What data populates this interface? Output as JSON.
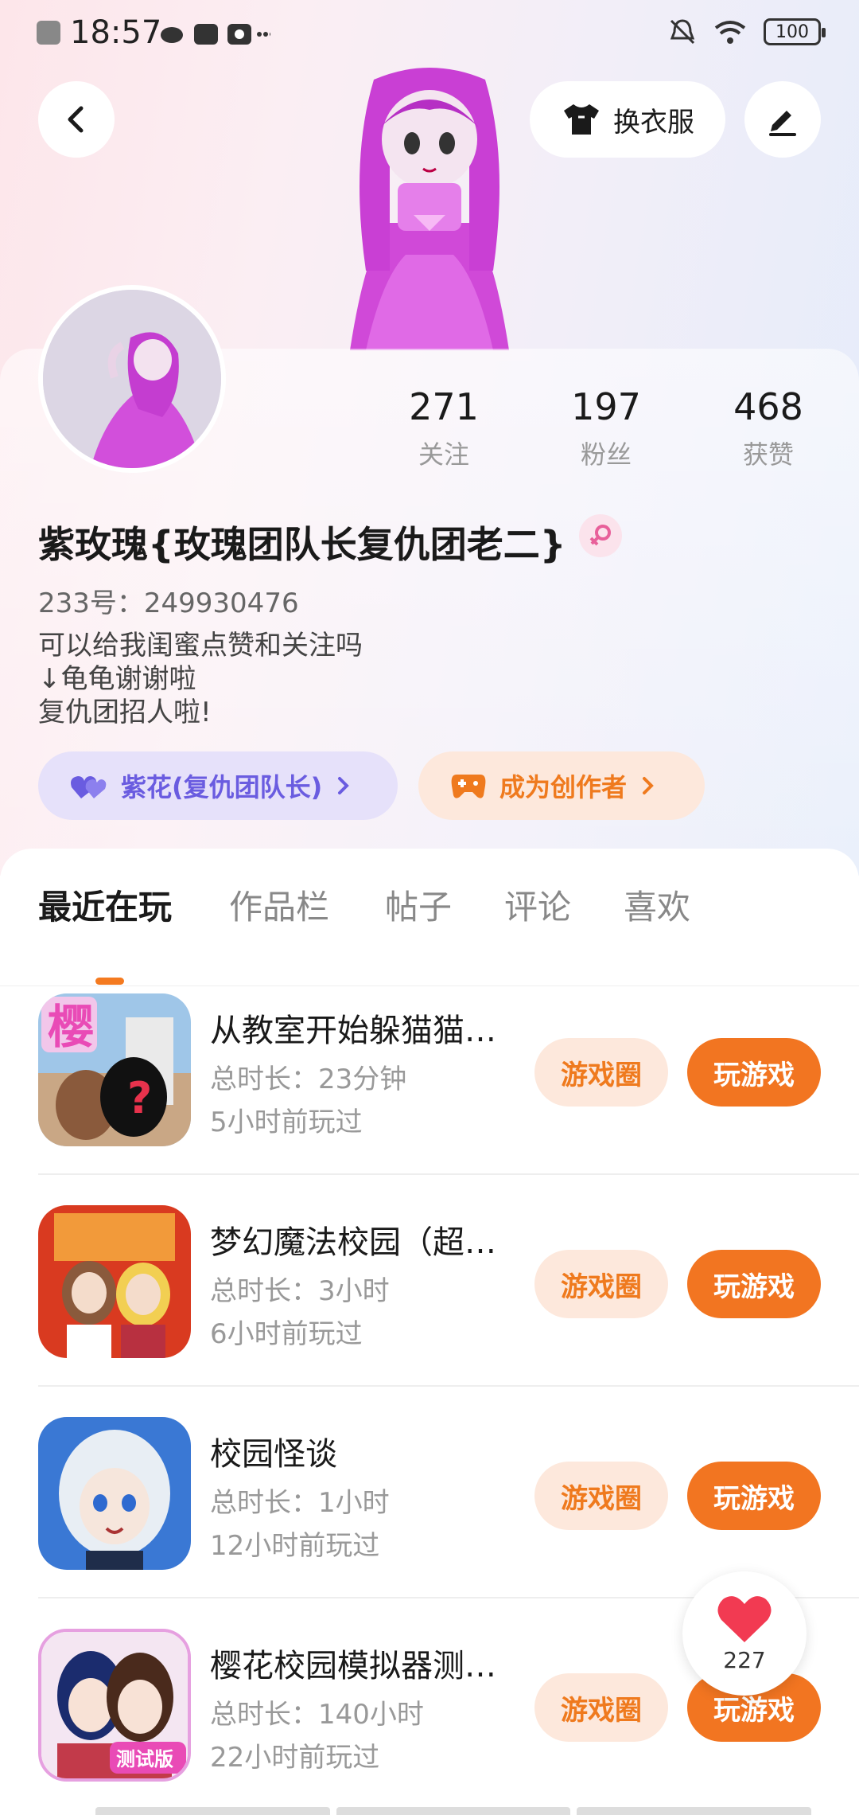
{
  "status_bar": {
    "time": "18:57",
    "battery": "100"
  },
  "header": {
    "dress_label": "换衣服"
  },
  "profile": {
    "name": "紫玫瑰{玫瑰团队长复仇团老二}",
    "uid": "233号：249930476",
    "bio_lines": [
      "可以给我闺蜜点赞和关注吗",
      "↓龟龟谢谢啦",
      "复仇团招人啦!"
    ],
    "stats": [
      {
        "num": "271",
        "label": "关注"
      },
      {
        "num": "197",
        "label": "粉丝"
      },
      {
        "num": "468",
        "label": "获赞"
      }
    ],
    "chip_relation": "紫花(复仇团队长)",
    "chip_creator": "成为创作者"
  },
  "tabs": [
    "最近在玩",
    "作品栏",
    "帖子",
    "评论",
    "喜欢"
  ],
  "games": [
    {
      "title": "从教室开始躲猫猫…",
      "duration": "总时长：23分钟",
      "last_played": "5小时前玩过"
    },
    {
      "title": "梦幻魔法校园（超…",
      "duration": "总时长：3小时",
      "last_played": "6小时前玩过"
    },
    {
      "title": "校园怪谈",
      "duration": "总时长：1小时",
      "last_played": "12小时前玩过"
    },
    {
      "title": "樱花校园模拟器测…",
      "duration": "总时长：140小时",
      "last_played": "22小时前玩过"
    }
  ],
  "game_buttons": {
    "circle": "游戏圈",
    "play": "玩游戏"
  },
  "thumb_labels": {
    "game1_char": "樱",
    "game4_badge": "测试版"
  },
  "like_count": "227",
  "colors": {
    "accent_orange": "#f27521",
    "chip_purple": "#6a5ce0"
  }
}
